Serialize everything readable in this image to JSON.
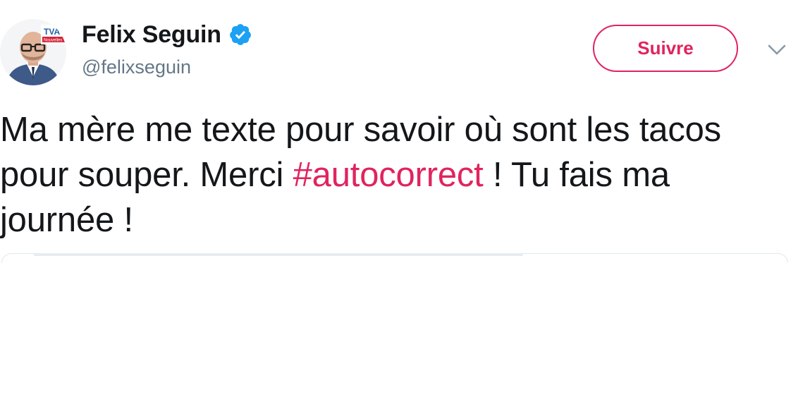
{
  "user": {
    "display_name": "Felix Seguin",
    "handle": "@felixseguin",
    "verified": true,
    "avatar_logo_text": "TVA",
    "avatar_logo_subtext": "Nouvelles"
  },
  "actions": {
    "follow_label": "Suivre",
    "menu_icon": "chevron-down-icon"
  },
  "tweet": {
    "text_before": "Ma mère me texte pour savoir où sont les tacos pour souper. Merci ",
    "hashtag": "#autocorrect",
    "text_after": " ! Tu fais ma journée !"
  },
  "colors": {
    "accent": "#e0245e",
    "verified": "#1da1f2",
    "text": "#14171a",
    "secondary_text": "#657786"
  }
}
